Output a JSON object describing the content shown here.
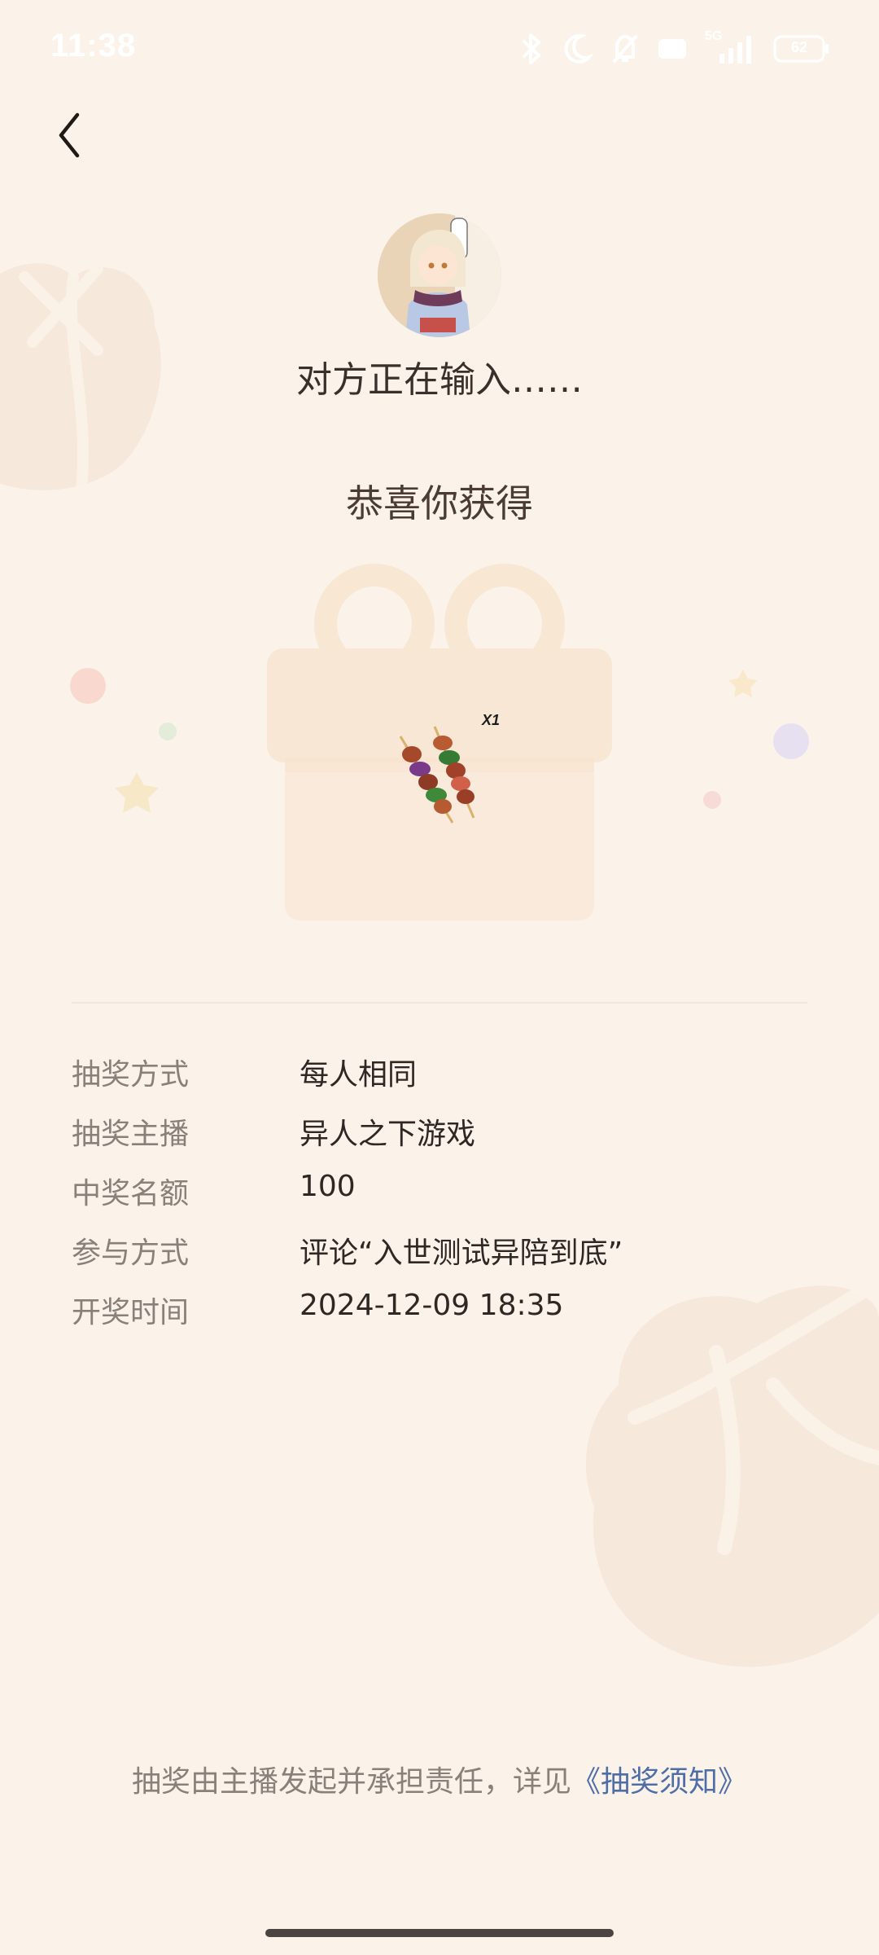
{
  "status_bar": {
    "time": "11:38",
    "network": "5G",
    "battery": "62"
  },
  "header": {
    "back_icon": "chevron-left-icon"
  },
  "lottery": {
    "typing_text": "对方正在输入……",
    "congrats_text": "恭喜你获得",
    "prize_icon": "skewer-icon",
    "prize_quantity": "X1"
  },
  "info": {
    "rows": [
      {
        "label": "抽奖方式",
        "value": "每人相同"
      },
      {
        "label": "抽奖主播",
        "value": "异人之下游戏"
      },
      {
        "label": "中奖名额",
        "value": "100"
      },
      {
        "label": "参与方式",
        "value": "评论“入世测试异陪到底”"
      },
      {
        "label": "开奖时间",
        "value": "2024-12-09 18:35"
      }
    ]
  },
  "footer": {
    "note": "抽奖由主播发起并承担责任，详见",
    "link": "《抽奖须知》"
  },
  "colors": {
    "background": "#fbf3ea",
    "link": "#4f6ea8",
    "label": "#8a807a"
  }
}
